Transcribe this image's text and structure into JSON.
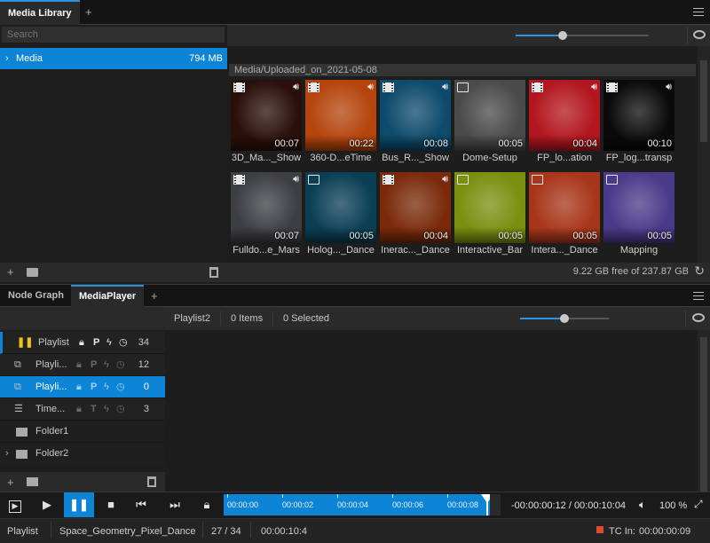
{
  "top_tabs": {
    "media_library": "Media Library",
    "add": "+"
  },
  "library": {
    "search_placeholder": "Search",
    "tree": [
      {
        "label": "Media",
        "size": "794 MB"
      }
    ],
    "path": "Media/Uploaded_on_2021-05-08",
    "disk_free": "9.22 GB free of 237.87 GB",
    "thumb_slider_level": 0.35,
    "items": [
      {
        "label": "3D_Ma..._Show",
        "duration": "00:07",
        "kind": "video",
        "audio": true,
        "bg": "#2a0f0a"
      },
      {
        "label": "360-D...eTime",
        "duration": "00:22",
        "kind": "video",
        "audio": true,
        "bg": "#b5440d"
      },
      {
        "label": "Bus_R..._Show",
        "duration": "00:08",
        "kind": "video",
        "audio": true,
        "bg": "#0d4a6b"
      },
      {
        "label": "Dome-Setup",
        "duration": "00:05",
        "kind": "image",
        "audio": false,
        "bg": "#4a4a4a"
      },
      {
        "label": "FP_lo...ation",
        "duration": "00:04",
        "kind": "video",
        "audio": true,
        "bg": "#b3161f"
      },
      {
        "label": "FP_log...transp",
        "duration": "00:10",
        "kind": "video",
        "audio": true,
        "bg": "#0a0a0a"
      },
      {
        "label": "Fulldo...e_Mars",
        "duration": "00:07",
        "kind": "video",
        "audio": true,
        "bg": "#3d3e42"
      },
      {
        "label": "Holog..._Dance",
        "duration": "00:05",
        "kind": "image",
        "audio": false,
        "bg": "#0b3f55"
      },
      {
        "label": "Inerac..._Dance",
        "duration": "00:04",
        "kind": "video",
        "audio": true,
        "bg": "#7a2a0a"
      },
      {
        "label": "Interactive_Bar",
        "duration": "00:05",
        "kind": "image",
        "audio": false,
        "bg": "#7a8f10"
      },
      {
        "label": "Intera..._Dance",
        "duration": "00:05",
        "kind": "image",
        "audio": false,
        "bg": "#a8361a"
      },
      {
        "label": "Mapping",
        "duration": "00:05",
        "kind": "image",
        "audio": false,
        "bg": "#4a3a8a"
      }
    ]
  },
  "bottom_tabs": {
    "node_graph": "Node Graph",
    "media_player": "MediaPlayer",
    "add": "+"
  },
  "player_toolbar": {
    "playlist": "Playlist2",
    "items": "0 Items",
    "selected": "0 Selected",
    "slider_level": 0.5
  },
  "playlists": [
    {
      "name": "Playlist",
      "flags": "P",
      "count": "34",
      "state": "playing"
    },
    {
      "name": "Playli...",
      "flags": "P",
      "count": "12",
      "state": "idle"
    },
    {
      "name": "Playli...",
      "flags": "P",
      "count": "0",
      "state": "selected"
    },
    {
      "name": "Time...",
      "flags": "T",
      "count": "3",
      "state": "timeline"
    }
  ],
  "folders": [
    {
      "name": "Folder1"
    },
    {
      "name": "Folder2"
    }
  ],
  "timeline": {
    "ticks": [
      "00:00:00",
      "00:00:02",
      "00:00:04",
      "00:00:06",
      "00:00:08"
    ],
    "time_display": "-00:00:00:12 / 00:00:10:04",
    "volume": "100 %"
  },
  "status": {
    "mode": "Playlist",
    "clip": "Space_Geometry_Pixel_Dance",
    "position": "27 / 34",
    "duration": "00:00:10:4",
    "tc_label": "TC In:",
    "tc_value": "00:00:00:09"
  }
}
